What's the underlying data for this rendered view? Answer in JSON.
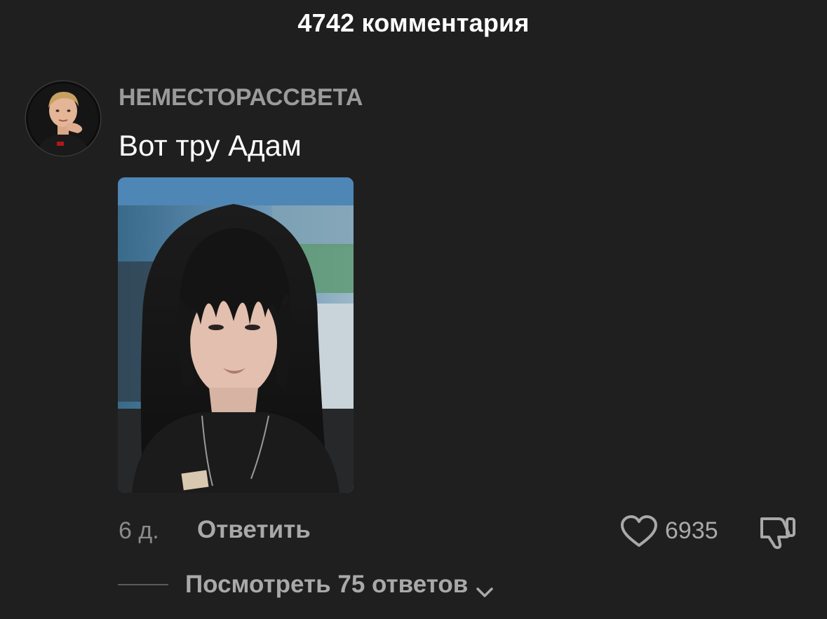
{
  "header": {
    "title": "4742 комментария"
  },
  "comment": {
    "avatar_icon": "user-avatar-photo",
    "username": "НЕМЕСТОРАССВЕТА",
    "text": "Вот тру Адам",
    "attachment": "photo",
    "time_ago": "6 д.",
    "reply_label": "Ответить",
    "like_icon": "heart-outline-icon",
    "like_count": "6935",
    "dislike_icon": "thumbs-down-icon",
    "view_replies_label": "Посмотреть 75 ответов",
    "view_replies_icon": "chevron-down-icon"
  },
  "colors": {
    "background": "#1f1f1f",
    "primary_text": "#ffffff",
    "secondary_text": "#a9a9a9",
    "username_text": "#9b9b9b"
  }
}
